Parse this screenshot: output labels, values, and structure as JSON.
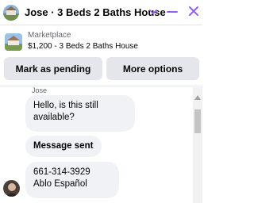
{
  "header": {
    "title": "Jose · 3 Beds 2 Baths House",
    "accent_color": "#9360f7"
  },
  "listing": {
    "source": "Marketplace",
    "title": "$1,200 - 3 Beds 2 Baths House"
  },
  "actions": {
    "mark_pending": "Mark as pending",
    "more_options": "More options"
  },
  "conversation": {
    "sender_name": "Jose",
    "messages": [
      {
        "line1": "Hello, is this still",
        "line2": "available?"
      },
      {
        "line1": "Message sent"
      },
      {
        "line1": "661-314-3929",
        "line2": "Ablo Español"
      }
    ]
  },
  "icons": {
    "chevron": "chevron-down-icon",
    "minimize": "minimize-icon",
    "close": "close-icon"
  }
}
